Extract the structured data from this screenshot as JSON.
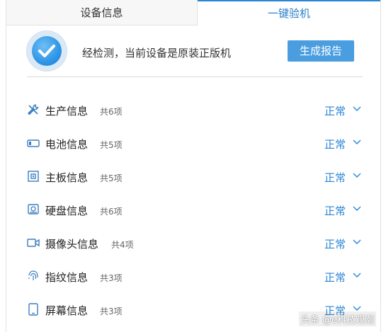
{
  "tabs": {
    "device_info": "设备信息",
    "inspection": "一键验机"
  },
  "result": {
    "message": "经检测，当前设备是原装正版机",
    "report_button": "生成报告"
  },
  "items": [
    {
      "title": "生产信息",
      "count": "共6项",
      "status": "正常",
      "icon": "tools-icon"
    },
    {
      "title": "电池信息",
      "count": "共5项",
      "status": "正常",
      "icon": "battery-icon"
    },
    {
      "title": "主板信息",
      "count": "共5项",
      "status": "正常",
      "icon": "chip-icon"
    },
    {
      "title": "硬盘信息",
      "count": "共6项",
      "status": "正常",
      "icon": "disk-icon"
    },
    {
      "title": "摄像头信息",
      "count": "共4项",
      "status": "正常",
      "icon": "camera-icon"
    },
    {
      "title": "指纹信息",
      "count": "共3项",
      "status": "正常",
      "icon": "fingerprint-icon"
    },
    {
      "title": "屏幕信息",
      "count": "共3项",
      "status": "正常",
      "icon": "screen-icon"
    }
  ],
  "watermark": "头条 @e科技观潮",
  "colors": {
    "accent": "#2a85d6",
    "button": "#4a9ee0"
  }
}
